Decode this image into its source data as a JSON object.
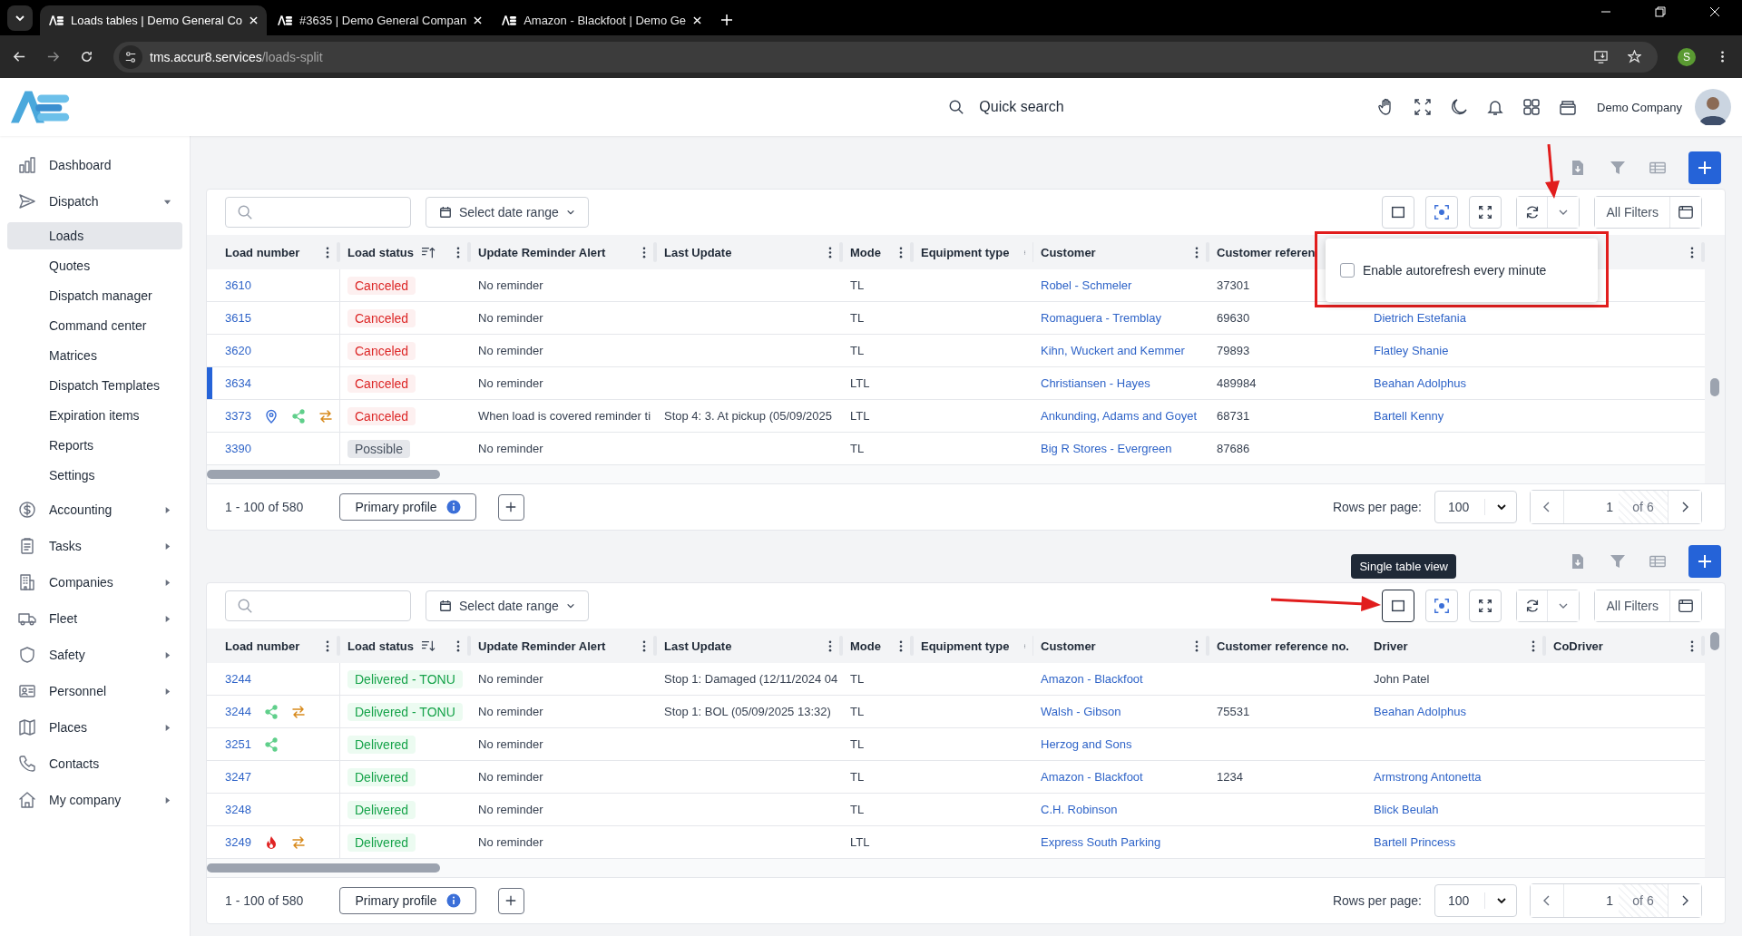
{
  "browser": {
    "tabs": [
      {
        "title": "Loads tables | Demo General Co",
        "selected": true
      },
      {
        "title": "#3635 | Demo General Compan",
        "selected": false
      },
      {
        "title": "Amazon - Blackfoot | Demo Ge",
        "selected": false
      }
    ],
    "address": {
      "host": "tms.accur8.services",
      "path": "/loads-split"
    },
    "profile_initial": "S"
  },
  "header": {
    "search_label": "Quick search",
    "company": "Demo Company"
  },
  "sidebar": {
    "items": [
      {
        "label": "Dashboard",
        "kind": "link"
      },
      {
        "label": "Dispatch",
        "kind": "group",
        "expanded": true,
        "children": [
          {
            "label": "Loads",
            "selected": true
          },
          {
            "label": "Quotes",
            "selected": false
          },
          {
            "label": "Dispatch manager",
            "selected": false
          },
          {
            "label": "Command center",
            "selected": false
          },
          {
            "label": "Matrices",
            "selected": false
          },
          {
            "label": "Dispatch Templates",
            "selected": false
          },
          {
            "label": "Expiration items",
            "selected": false
          },
          {
            "label": "Reports",
            "selected": false
          },
          {
            "label": "Settings",
            "selected": false
          }
        ]
      },
      {
        "label": "Accounting",
        "kind": "group",
        "expanded": false
      },
      {
        "label": "Tasks",
        "kind": "group",
        "expanded": false
      },
      {
        "label": "Companies",
        "kind": "group",
        "expanded": false
      },
      {
        "label": "Fleet",
        "kind": "group",
        "expanded": false
      },
      {
        "label": "Safety",
        "kind": "group",
        "expanded": false
      },
      {
        "label": "Personnel",
        "kind": "group",
        "expanded": false
      },
      {
        "label": "Places",
        "kind": "group",
        "expanded": false
      },
      {
        "label": "Contacts",
        "kind": "link"
      },
      {
        "label": "My company",
        "kind": "group",
        "expanded": false
      }
    ]
  },
  "tables": [
    {
      "date_range": "Select date range",
      "all_filters": "All Filters",
      "annotation": {
        "kind": "down"
      },
      "popup": {
        "label": "Enable autorefresh every minute",
        "checked": false,
        "highlighted": true
      },
      "columns": [
        {
          "label": "Load number",
          "kind": "plain"
        },
        {
          "label": "Load status",
          "kind": "sort-asc"
        },
        {
          "label": "Update Reminder Alert",
          "kind": "plain"
        },
        {
          "label": "Last Update",
          "kind": "plain"
        },
        {
          "label": "Mode",
          "kind": "plain"
        },
        {
          "label": "Equipment type",
          "kind": "plain"
        },
        {
          "label": "Customer",
          "kind": "plain"
        },
        {
          "label": "Customer referen",
          "kind": "plain"
        },
        {
          "kind": "plain"
        },
        {
          "kind": "plain"
        }
      ],
      "rows": [
        {
          "load_number": "3610",
          "selected": false,
          "badges": [],
          "status": {
            "text": "Canceled",
            "kind": "canceled"
          },
          "reminder": "No reminder",
          "mode": "TL",
          "customer": "Robel - Schmeler",
          "customer_ref": "37301"
        },
        {
          "load_number": "3615",
          "selected": false,
          "badges": [],
          "status": {
            "text": "Canceled",
            "kind": "canceled"
          },
          "reminder": "No reminder",
          "mode": "TL",
          "customer": "Romaguera - Tremblay",
          "customer_ref": "69630",
          "driver": {
            "name": "Dietrich Estefania",
            "linked": true
          }
        },
        {
          "load_number": "3620",
          "selected": false,
          "badges": [],
          "status": {
            "text": "Canceled",
            "kind": "canceled"
          },
          "reminder": "No reminder",
          "mode": "TL",
          "customer": "Kihn, Wuckert and Kemmer",
          "customer_ref": "79893",
          "driver": {
            "name": "Flatley Shanie",
            "linked": true
          }
        },
        {
          "load_number": "3634",
          "selected": true,
          "badges": [],
          "status": {
            "text": "Canceled",
            "kind": "canceled"
          },
          "reminder": "No reminder",
          "mode": "LTL",
          "customer": "Christiansen - Hayes",
          "customer_ref": "489984",
          "driver": {
            "name": "Beahan Adolphus",
            "linked": true
          }
        },
        {
          "load_number": "3373",
          "selected": false,
          "badges": [
            {
              "kind": "location"
            },
            {
              "kind": "share"
            },
            {
              "kind": "transfer"
            }
          ],
          "status": {
            "text": "Canceled",
            "kind": "canceled"
          },
          "reminder": "When load is covered reminder ti",
          "last_update": "Stop 4: 3. At pickup (05/09/2025",
          "mode": "LTL",
          "customer": "Ankunding, Adams and Goyet",
          "customer_ref": "68731",
          "driver": {
            "name": "Bartell Kenny",
            "linked": true
          }
        },
        {
          "load_number": "3390",
          "selected": false,
          "badges": [],
          "status": {
            "text": "Possible",
            "kind": "possible"
          },
          "reminder": "No reminder",
          "mode": "TL",
          "customer": "Big R Stores - Evergreen",
          "customer_ref": "87686"
        }
      ],
      "footer": {
        "range": "1 - 100 of 580",
        "profile": "Primary profile",
        "rows_label": "Rows per page:",
        "rows_value": "100",
        "page": "1",
        "page_of": "of 6"
      }
    },
    {
      "date_range": "Select date range",
      "all_filters": "All Filters",
      "annotation": {
        "kind": "left"
      },
      "tooltip": "Single table view",
      "columns": [
        {
          "label": "Load number",
          "kind": "plain"
        },
        {
          "label": "Load status",
          "kind": "sort-desc"
        },
        {
          "label": "Update Reminder Alert",
          "kind": "plain"
        },
        {
          "label": "Last Update",
          "kind": "plain"
        },
        {
          "label": "Mode",
          "kind": "plain"
        },
        {
          "label": "Equipment type",
          "kind": "plain"
        },
        {
          "label": "Customer",
          "kind": "plain"
        },
        {
          "label": "Customer reference no.",
          "kind": "plain"
        },
        {
          "label": "Driver",
          "kind": "plain"
        },
        {
          "label": "CoDriver",
          "kind": "plain"
        }
      ],
      "rows": [
        {
          "load_number": "3244",
          "selected": false,
          "badges": [],
          "status": {
            "text": "Delivered - TONU",
            "kind": "delivered"
          },
          "reminder": "No reminder",
          "last_update": "Stop 1: Damaged (12/11/2024 04",
          "mode": "TL",
          "customer": "Amazon - Blackfoot",
          "driver": {
            "name": "John Patel",
            "linked": false
          }
        },
        {
          "load_number": "3244",
          "selected": false,
          "badges": [
            {
              "kind": "share"
            },
            {
              "kind": "transfer"
            }
          ],
          "status": {
            "text": "Delivered - TONU",
            "kind": "delivered"
          },
          "reminder": "No reminder",
          "last_update": "Stop 1: BOL (05/09/2025 13:32)",
          "mode": "TL",
          "customer": "Walsh - Gibson",
          "customer_ref": "75531",
          "driver": {
            "name": "Beahan Adolphus",
            "linked": true
          }
        },
        {
          "load_number": "3251",
          "selected": false,
          "badges": [
            {
              "kind": "share"
            }
          ],
          "status": {
            "text": "Delivered",
            "kind": "delivered"
          },
          "reminder": "No reminder",
          "mode": "TL",
          "customer": "Herzog and Sons"
        },
        {
          "load_number": "3247",
          "selected": false,
          "badges": [],
          "status": {
            "text": "Delivered",
            "kind": "delivered"
          },
          "reminder": "No reminder",
          "mode": "TL",
          "customer": "Amazon - Blackfoot",
          "customer_ref": "1234",
          "driver": {
            "name": "Armstrong Antonetta",
            "linked": true
          }
        },
        {
          "load_number": "3248",
          "selected": false,
          "badges": [],
          "status": {
            "text": "Delivered",
            "kind": "delivered"
          },
          "reminder": "No reminder",
          "mode": "TL",
          "customer": "C.H. Robinson",
          "driver": {
            "name": "Blick Beulah",
            "linked": true
          }
        },
        {
          "load_number": "3249",
          "selected": false,
          "badges": [
            {
              "kind": "fire"
            },
            {
              "kind": "transfer"
            }
          ],
          "status": {
            "text": "Delivered",
            "kind": "delivered"
          },
          "reminder": "No reminder",
          "mode": "LTL",
          "customer": "Express South Parking",
          "driver": {
            "name": "Bartell Princess",
            "linked": true
          }
        }
      ],
      "footer": {
        "range": "1 - 100 of 580",
        "profile": "Primary profile",
        "rows_label": "Rows per page:",
        "rows_value": "100",
        "page": "1",
        "page_of": "of 6"
      }
    }
  ]
}
